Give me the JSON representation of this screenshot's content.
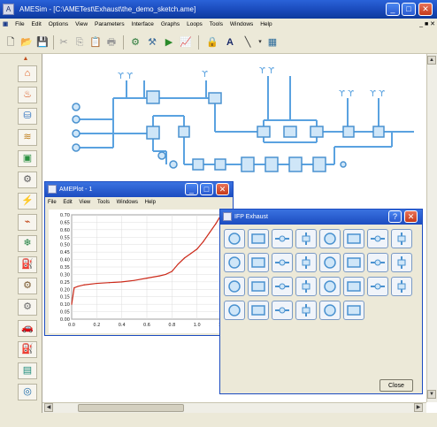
{
  "main_window": {
    "title": "AMESim - [C:\\AMETest\\Exhaust\\the_demo_sketch.ame]",
    "app_icon": "A"
  },
  "window_controls": {
    "minimize_glyph": "_",
    "maximize_glyph": "□",
    "close_glyph": "✕"
  },
  "menubar": {
    "items": [
      "File",
      "Edit",
      "Options",
      "View",
      "Parameters",
      "Interface",
      "Graphs",
      "Loops",
      "Tools",
      "Windows",
      "Help"
    ],
    "mdi_controls": "_ ■ ✕"
  },
  "toolbar": {
    "icons": [
      "new-file-icon",
      "open-folder-icon",
      "save-icon",
      "cut-icon",
      "copy-icon",
      "paste-icon",
      "print-icon",
      "sketch-mode-icon",
      "parameter-mode-icon",
      "run-mode-icon",
      "plot-icon",
      "lock-icon",
      "text-icon",
      "line-icon",
      "image-icon"
    ],
    "glyphs": [
      "🗋",
      "📂",
      "💾",
      "✂",
      "⎘",
      "📋",
      "🖶",
      "⚙",
      "⚒",
      "▶",
      "📈",
      "🔒",
      "A",
      "╲",
      "▦"
    ]
  },
  "palette": {
    "icons": [
      "exhaust-library-icon",
      "thermal-library-icon",
      "pneumatic-library-icon",
      "hydraulic-library-icon",
      "signal-library-icon",
      "mechanical-library-icon",
      "electric-library-icon",
      "control-library-icon",
      "cooling-library-icon",
      "gas-library-icon",
      "powertrain-library-icon",
      "engine-library-icon",
      "vehicle-library-icon",
      "fuel-library-icon",
      "filter-library-icon",
      "ifp-library-icon"
    ],
    "glyphs": [
      "⌂",
      "♨",
      "⛁",
      "≋",
      "▣",
      "⚙",
      "⚡",
      "⌁",
      "❄",
      "⛽",
      "⚙",
      "⚙",
      "🚗",
      "⛽",
      "▤",
      "◎"
    ],
    "colors": [
      "#e05a1a",
      "#d44a10",
      "#2a70c0",
      "#c08020",
      "#2a9040",
      "#5a5a5a",
      "#d43020",
      "#c04010",
      "#208040",
      "#3060a0",
      "#7a5a30",
      "#6a6a6a",
      "#2a8a5a",
      "#5a8a2a",
      "#1a8a7a",
      "#1a6aaa"
    ]
  },
  "amesplot": {
    "title": "AMEPlot - 1",
    "menu": [
      "File",
      "Edit",
      "View",
      "Tools",
      "Windows",
      "Help"
    ],
    "chart_data": {
      "type": "line",
      "x": [
        0.0,
        0.02,
        0.05,
        0.1,
        0.2,
        0.3,
        0.4,
        0.5,
        0.6,
        0.7,
        0.75,
        0.8,
        0.85,
        0.9,
        0.95,
        1.0,
        1.05,
        1.1,
        1.15,
        1.2
      ],
      "series": [
        {
          "values": [
            0.1,
            0.21,
            0.22,
            0.23,
            0.24,
            0.245,
            0.25,
            0.26,
            0.275,
            0.29,
            0.3,
            0.32,
            0.37,
            0.41,
            0.44,
            0.47,
            0.52,
            0.58,
            0.64,
            0.71
          ],
          "color": "#cc2a1a"
        }
      ],
      "xlim": [
        0,
        1.2
      ],
      "ylim": [
        0.0,
        0.7
      ],
      "x_ticks": [
        "0.0",
        "0.2",
        "0.4",
        "0.6",
        "0.8",
        "1.0",
        "1.2"
      ],
      "y_ticks": [
        "0.70",
        "0.65",
        "0.60",
        "0.55",
        "0.50",
        "0.45",
        "0.40",
        "0.35",
        "0.30",
        "0.25",
        "0.20",
        "0.15",
        "0.10",
        "0.05",
        "0.00"
      ],
      "grid": true
    }
  },
  "ifp_exhaust": {
    "title": "IFP Exhaust",
    "help_glyph": "?",
    "close_button_label": "Close",
    "components": [
      "engine-block-icon",
      "pipe-icon",
      "valve-icon",
      "sensor-icon",
      "junction-icon",
      "catalyst-icon",
      "muffler-icon",
      "filter-icon",
      "turbine-icon",
      "chamber-icon",
      "ambient-icon",
      "bend-icon"
    ]
  },
  "canvas": {
    "accent_color": "#6aaee8"
  }
}
